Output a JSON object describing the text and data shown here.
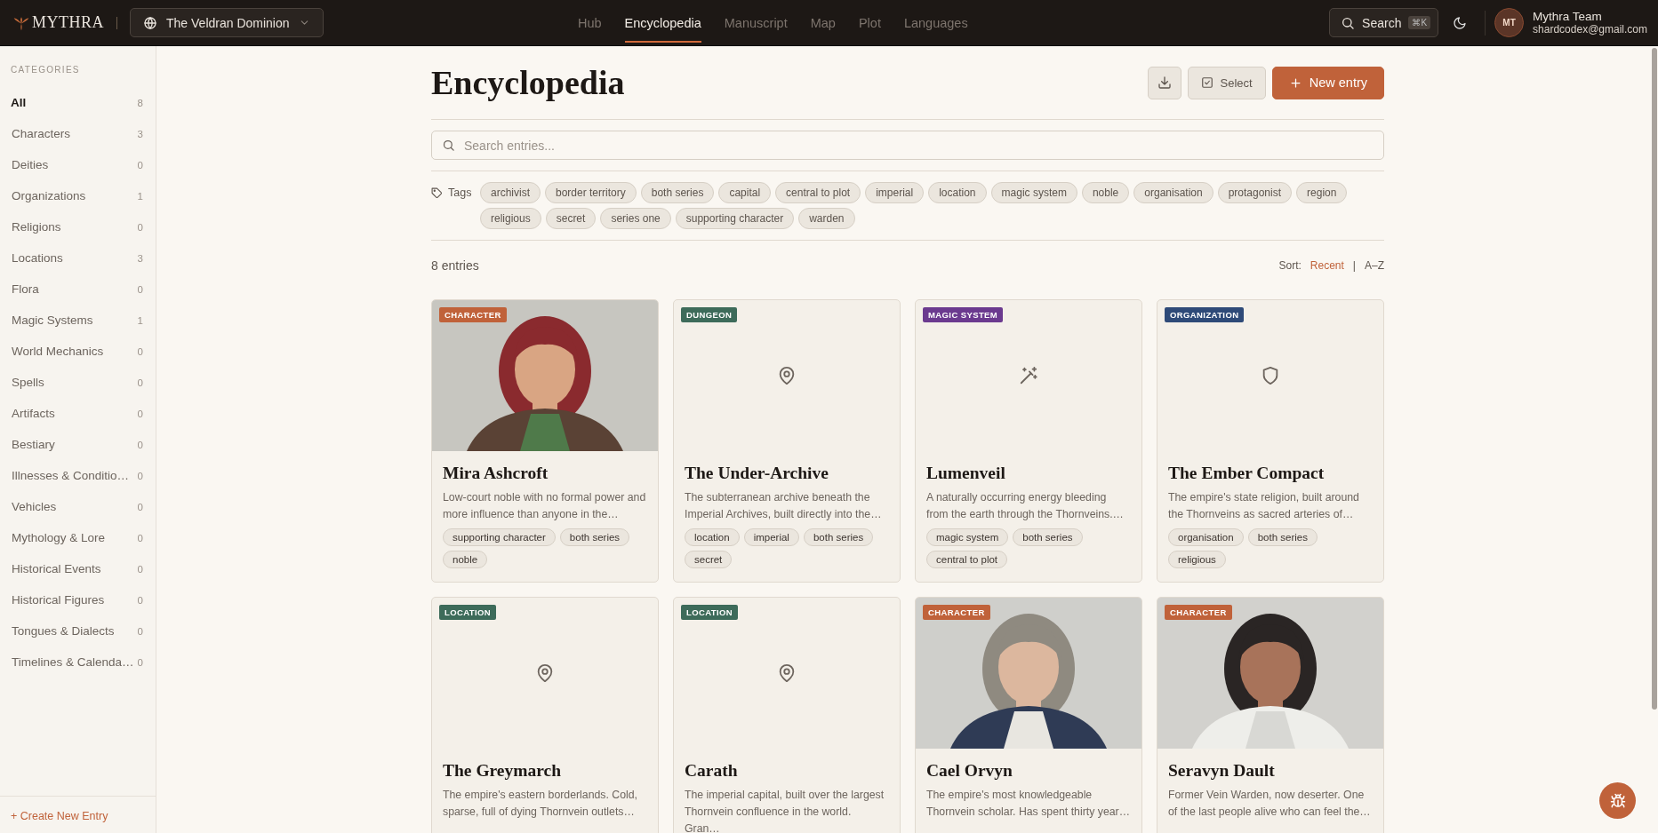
{
  "topbar": {
    "brand": "MYTHRA",
    "world": "The Veldran Dominion",
    "nav": [
      {
        "label": "Hub",
        "selected": false
      },
      {
        "label": "Encyclopedia",
        "selected": true
      },
      {
        "label": "Manuscript",
        "selected": false
      },
      {
        "label": "Map",
        "selected": false
      },
      {
        "label": "Plot",
        "selected": false
      },
      {
        "label": "Languages",
        "selected": false
      }
    ],
    "search": "Search",
    "shortcut": "⌘K",
    "user": {
      "initials": "MT",
      "name": "Mythra Team",
      "email": "shardcodex@gmail.com"
    }
  },
  "sidebar": {
    "heading": "CATEGORIES",
    "items": [
      {
        "label": "All",
        "count": "8",
        "selected": true
      },
      {
        "label": "Characters",
        "count": "3",
        "selected": false
      },
      {
        "label": "Deities",
        "count": "0",
        "selected": false
      },
      {
        "label": "Organizations",
        "count": "1",
        "selected": false
      },
      {
        "label": "Religions",
        "count": "0",
        "selected": false
      },
      {
        "label": "Locations",
        "count": "3",
        "selected": false
      },
      {
        "label": "Flora",
        "count": "0",
        "selected": false
      },
      {
        "label": "Magic Systems",
        "count": "1",
        "selected": false
      },
      {
        "label": "World Mechanics",
        "count": "0",
        "selected": false
      },
      {
        "label": "Spells",
        "count": "0",
        "selected": false
      },
      {
        "label": "Artifacts",
        "count": "0",
        "selected": false
      },
      {
        "label": "Bestiary",
        "count": "0",
        "selected": false
      },
      {
        "label": "Illnesses & Conditio…",
        "count": "0",
        "selected": false
      },
      {
        "label": "Vehicles",
        "count": "0",
        "selected": false
      },
      {
        "label": "Mythology & Lore",
        "count": "0",
        "selected": false
      },
      {
        "label": "Historical Events",
        "count": "0",
        "selected": false
      },
      {
        "label": "Historical Figures",
        "count": "0",
        "selected": false
      },
      {
        "label": "Tongues & Dialects",
        "count": "0",
        "selected": false
      },
      {
        "label": "Timelines & Calenda…",
        "count": "0",
        "selected": false
      }
    ],
    "create": "+ Create New Entry"
  },
  "page": {
    "title": "Encyclopedia",
    "select_button": "Select",
    "new_button": "New entry",
    "search_placeholder": "Search entries...",
    "tags_label": "Tags",
    "tags": [
      "archivist",
      "border territory",
      "both series",
      "capital",
      "central to plot",
      "imperial",
      "location",
      "magic system",
      "noble",
      "organisation",
      "protagonist",
      "region",
      "religious",
      "secret",
      "series one",
      "supporting character",
      "warden"
    ],
    "entry_count": "8 entries",
    "sort_label": "Sort:",
    "sort_separator": "|",
    "sort_options": [
      {
        "label": "Recent",
        "selected": true
      },
      {
        "label": "A–Z",
        "selected": false
      }
    ]
  },
  "cards": [
    {
      "kind": "picture",
      "category": "CHARACTER",
      "color": "#c0623a",
      "title": "Mira Ashcroft",
      "description": "Low-court noble with no formal power and more influence than anyone in the…",
      "tags": [
        "supporting character",
        "both series",
        "noble"
      ]
    },
    {
      "kind": "pin",
      "category": "DUNGEON",
      "color": "#3d6b5a",
      "title": "The Under-Archive",
      "description": "The subterranean archive beneath the Imperial Archives, built directly into the…",
      "tags": [
        "location",
        "imperial",
        "both series",
        "secret"
      ]
    },
    {
      "kind": "wand",
      "category": "MAGIC SYSTEM",
      "color": "#6b3a8f",
      "title": "Lumenveil",
      "description": "A naturally occurring energy bleeding from the earth through the Thornveins.…",
      "tags": [
        "magic system",
        "both series",
        "central to plot"
      ]
    },
    {
      "kind": "shield",
      "category": "ORGANIZATION",
      "color": "#2e4a78",
      "title": "The Ember Compact",
      "description": "The empire's state religion, built around the Thornveins as sacred arteries of…",
      "tags": [
        "organisation",
        "both series",
        "religious"
      ]
    },
    {
      "kind": "pin",
      "category": "LOCATION",
      "color": "#3d6b5a",
      "title": "The Greymarch",
      "description": "The empire's eastern borderlands. Cold, sparse, full of dying Thornvein outlets…"
    },
    {
      "kind": "pin",
      "category": "LOCATION",
      "color": "#3d6b5a",
      "title": "Carath",
      "description": "The imperial capital, built over the largest Thornvein confluence in the world. Gran…"
    },
    {
      "kind": "picture",
      "category": "CHARACTER",
      "color": "#c0623a",
      "title": "Cael Orvyn",
      "description": "The empire's most knowledgeable Thornvein scholar. Has spent thirty year…"
    },
    {
      "kind": "picture",
      "category": "CHARACTER",
      "color": "#c0623a",
      "title": "Seravyn Dault",
      "description": "Former Vein Warden, now deserter. One of the last people alive who can feel the…"
    }
  ]
}
